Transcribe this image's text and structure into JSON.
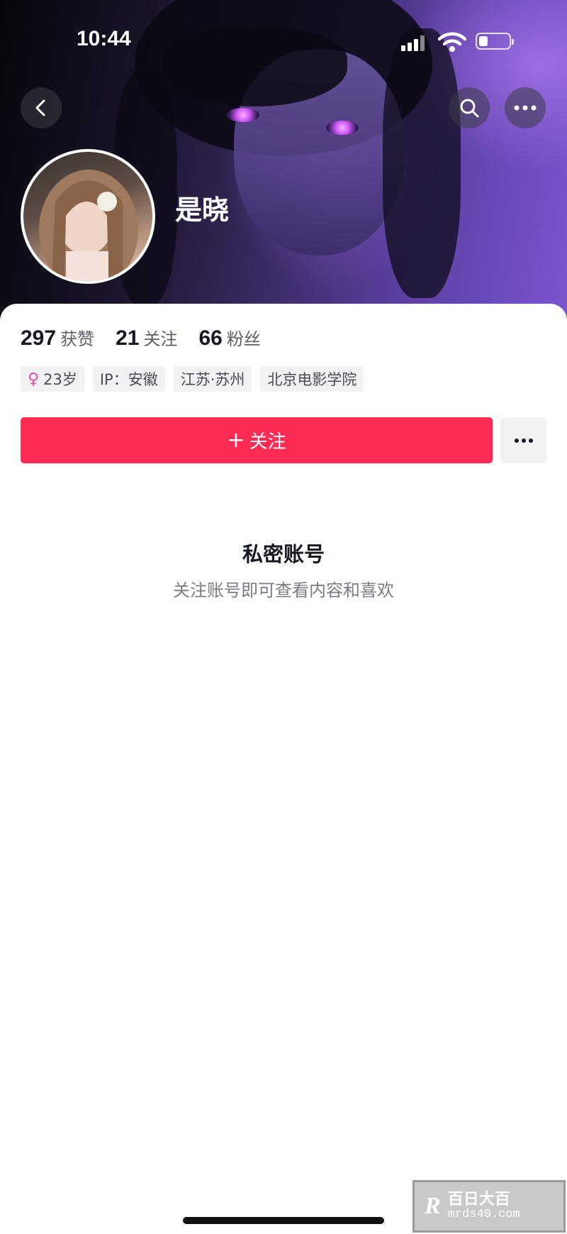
{
  "status_bar": {
    "time": "10:44"
  },
  "profile": {
    "nickname": "是晓",
    "stats": [
      {
        "value": "297",
        "label": "获赞"
      },
      {
        "value": "21",
        "label": "关注"
      },
      {
        "value": "66",
        "label": "粉丝"
      }
    ],
    "tags": [
      {
        "icon": "female-icon",
        "text": "23岁"
      },
      {
        "text": "IP：安徽"
      },
      {
        "text": "江苏·苏州"
      },
      {
        "text": "北京电影学院"
      }
    ]
  },
  "actions": {
    "follow_label": "关注",
    "follow_plus": "+"
  },
  "private": {
    "title": "私密账号",
    "subtitle": "关注账号即可查看内容和喜欢"
  },
  "watermark": {
    "logo": "R",
    "line1": "百日大百",
    "line2": "mrds40.com"
  },
  "colors": {
    "accent": "#fe2c55",
    "tag_bg": "#f2f2f4"
  }
}
